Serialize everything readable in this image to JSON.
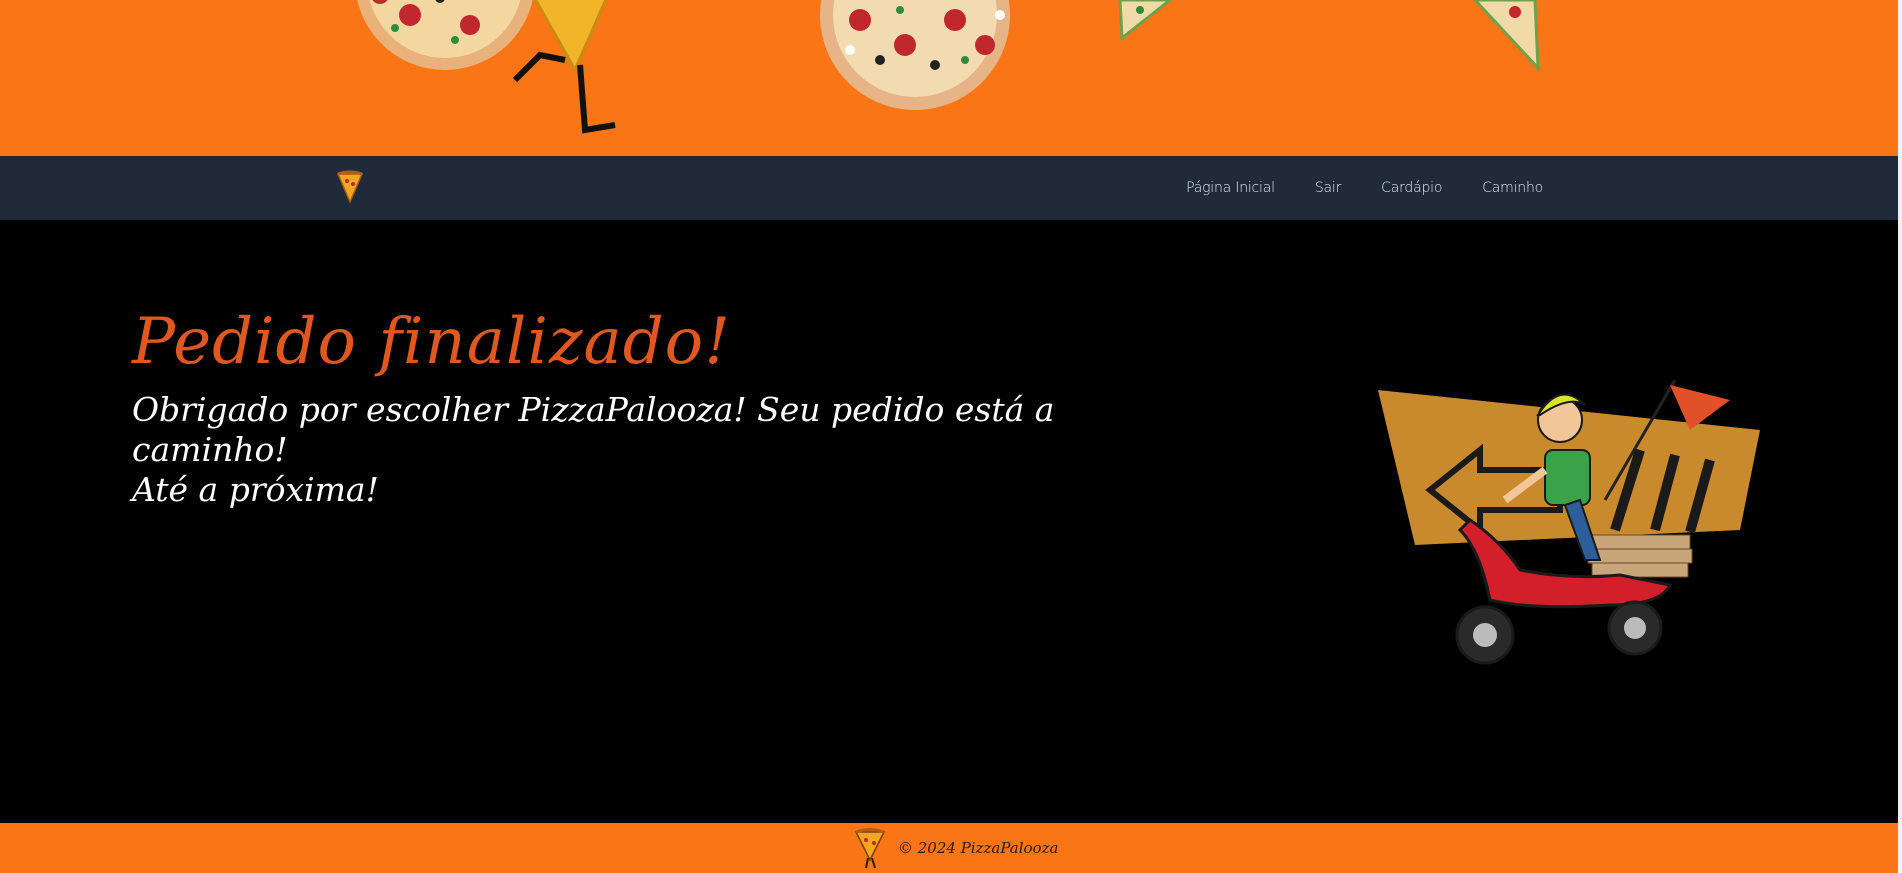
{
  "nav": {
    "links": [
      {
        "label": "Página Inicial"
      },
      {
        "label": "Sair"
      },
      {
        "label": "Cardápio"
      },
      {
        "label": "Caminho"
      }
    ]
  },
  "main": {
    "title": "Pedido finalizado!",
    "message_line1": "Obrigado por escolher PizzaPalooza! Seu pedido está a caminho!",
    "message_line2": "Até a próxima!"
  },
  "footer": {
    "copyright": "© 2024 PizzaPalooza"
  },
  "colors": {
    "brand_orange": "#f97516",
    "navbar": "#212a38",
    "title": "#e0571f",
    "background": "#000000"
  },
  "icons": {
    "nav_logo": "pizza-slice-icon",
    "footer_logo": "pizza-mascot-icon",
    "illustration": "delivery-scooter-illustration"
  }
}
